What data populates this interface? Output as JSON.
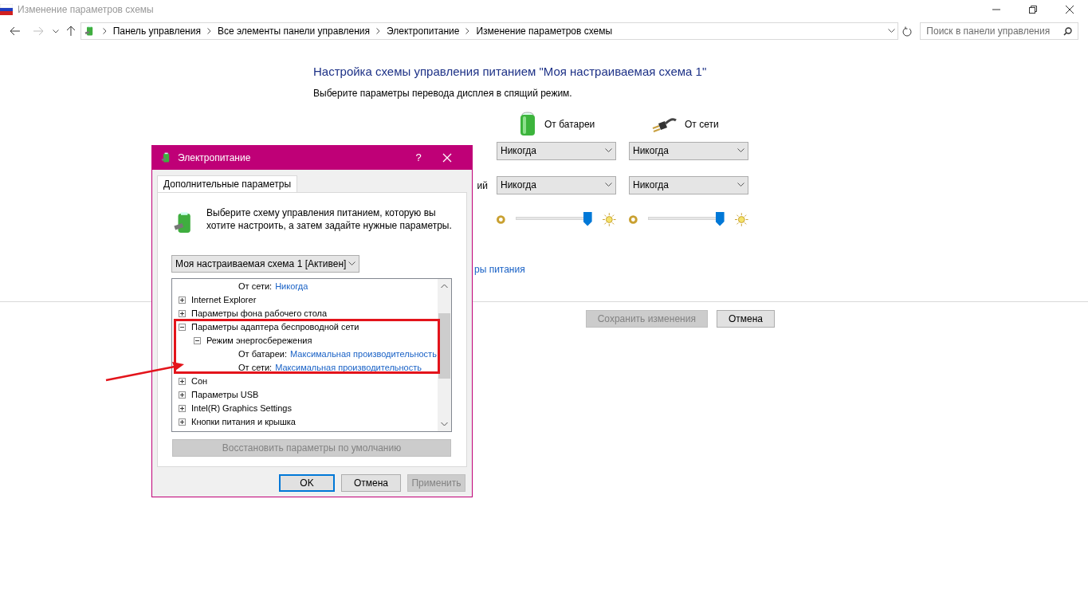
{
  "window": {
    "title": "Изменение параметров схемы"
  },
  "address_bar": {
    "breadcrumbs": [
      "Панель управления",
      "Все элементы панели управления",
      "Электропитание",
      "Изменение параметров схемы"
    ]
  },
  "search": {
    "placeholder": "Поиск в панели управления"
  },
  "heading": "Настройка схемы управления питанием \"Моя настраиваемая схема 1\"",
  "subheading": "Выберите параметры перевода дисплея в спящий режим.",
  "columns": [
    {
      "label": "От батареи",
      "kind": "battery"
    },
    {
      "label": "От сети",
      "kind": "plug"
    }
  ],
  "settings": [
    {
      "kind": "dropdown",
      "cells": [
        {
          "value": "Никогда"
        },
        {
          "value": "Никогда"
        }
      ]
    },
    {
      "kind": "dropdown",
      "label": "ий",
      "cells": [
        {
          "value": "Никогда"
        },
        {
          "value": "Никогда"
        }
      ]
    },
    {
      "kind": "slider",
      "cells": [
        {
          "level": 0.95
        },
        {
          "level": 0.95
        }
      ]
    }
  ],
  "link": "ры питания",
  "buttons": [
    {
      "label": "Сохранить изменения",
      "disabled": true
    },
    {
      "label": "Отмена",
      "disabled": false
    }
  ],
  "dialog": {
    "title": "Электропитание",
    "help": "?",
    "tabs": [
      {
        "label": "Дополнительные параметры",
        "selected": true
      }
    ],
    "intro": "Выберите схему управления питанием, которую вы хотите настроить, а затем задайте нужные параметры.",
    "scheme": "Моя настраиваемая схема 1 [Активен]",
    "tree": [
      {
        "children": [
          {
            "children": [
              {
                "label": "От сети:",
                "value": "Никогда"
              }
            ]
          }
        ]
      },
      {
        "label": "Internet Explorer",
        "expanded": false
      },
      {
        "label": "Параметры фона рабочего стола",
        "expanded": false
      },
      {
        "label": "Параметры адаптера беспроводной сети",
        "expanded": true,
        "children": [
          {
            "label": "Режим энергосбережения",
            "expanded": true,
            "children": [
              {
                "label": "От батареи:",
                "value": "Максимальная производительность"
              },
              {
                "label": "От сети:",
                "value": "Максимальная производительность"
              }
            ]
          }
        ]
      },
      {
        "label": "Сон",
        "expanded": false
      },
      {
        "label": "Параметры USB",
        "expanded": false
      },
      {
        "label": "Intel(R) Graphics Settings",
        "expanded": false
      },
      {
        "label": "Кнопки питания и крышка",
        "expanded": false
      }
    ],
    "restore": {
      "label": "Восстановить параметры по умолчанию",
      "disabled": true
    },
    "buttons": [
      {
        "label": "OK",
        "disabled": false,
        "default": true
      },
      {
        "label": "Отмена",
        "disabled": false,
        "default": false
      },
      {
        "label": "Применить",
        "disabled": true,
        "default": false
      }
    ]
  }
}
